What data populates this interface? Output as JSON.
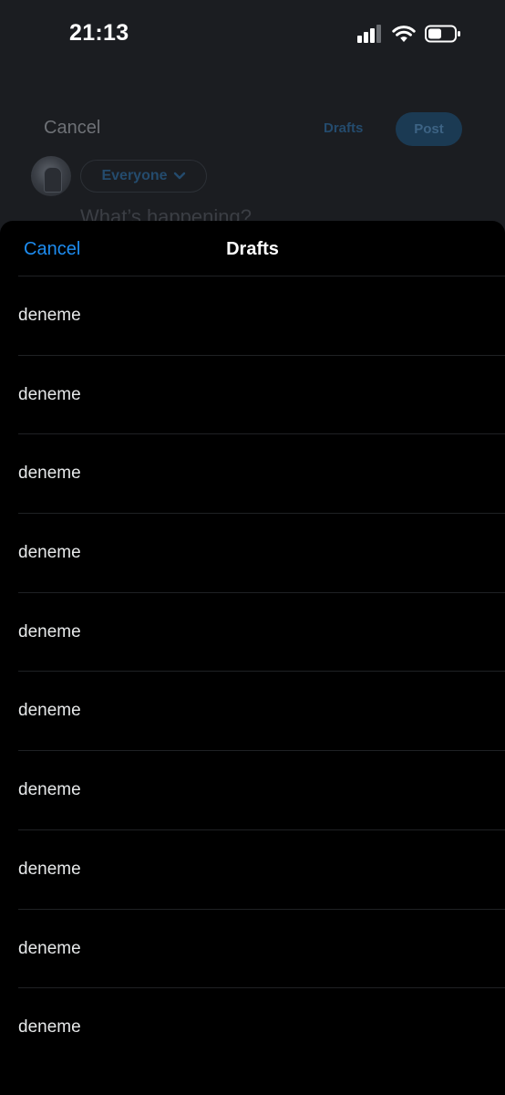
{
  "status_bar": {
    "time": "21:13"
  },
  "composer": {
    "cancel_label": "Cancel",
    "drafts_label": "Drafts",
    "post_label": "Post",
    "audience_label": "Everyone",
    "placeholder": "What’s happening?"
  },
  "drafts_sheet": {
    "cancel_label": "Cancel",
    "title": "Drafts",
    "items": [
      {
        "text": "deneme"
      },
      {
        "text": "deneme"
      },
      {
        "text": "deneme"
      },
      {
        "text": "deneme"
      },
      {
        "text": "deneme"
      },
      {
        "text": "deneme"
      },
      {
        "text": "deneme"
      },
      {
        "text": "deneme"
      },
      {
        "text": "deneme"
      },
      {
        "text": "deneme"
      }
    ]
  },
  "colors": {
    "accent": "#1d8cf0",
    "sheet_background": "#000000",
    "backdrop": "#1b1d21"
  }
}
